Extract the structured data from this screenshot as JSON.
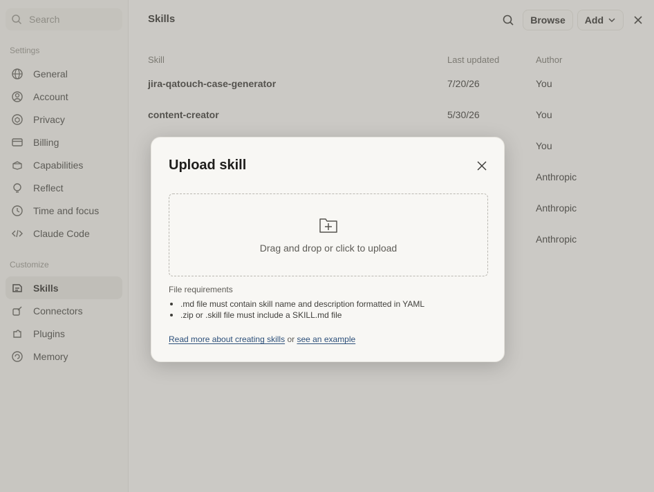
{
  "sidebar": {
    "search_placeholder": "Search",
    "settings_title": "Settings",
    "settings_items": [
      {
        "label": "General",
        "icon": "globe-icon"
      },
      {
        "label": "Account",
        "icon": "user-icon"
      },
      {
        "label": "Privacy",
        "icon": "shield-icon"
      },
      {
        "label": "Billing",
        "icon": "credit-card-icon"
      },
      {
        "label": "Capabilities",
        "icon": "cube-icon"
      },
      {
        "label": "Reflect",
        "icon": "lightbulb-icon"
      },
      {
        "label": "Time and focus",
        "icon": "clock-icon"
      },
      {
        "label": "Claude Code",
        "icon": "code-icon"
      }
    ],
    "customize_title": "Customize",
    "customize_items": [
      {
        "label": "Skills",
        "icon": "skills-icon",
        "active": true
      },
      {
        "label": "Connectors",
        "icon": "plug-icon"
      },
      {
        "label": "Plugins",
        "icon": "puzzle-icon"
      },
      {
        "label": "Memory",
        "icon": "memory-icon"
      }
    ]
  },
  "header": {
    "title": "Skills",
    "browse_label": "Browse",
    "add_label": "Add"
  },
  "table": {
    "columns": [
      "Skill",
      "Last updated",
      "Author"
    ],
    "rows": [
      {
        "skill": "jira-qatouch-case-generator",
        "updated": "7/20/26",
        "author": "You"
      },
      {
        "skill": "content-creator",
        "updated": "5/30/26",
        "author": "You"
      },
      {
        "skill": "",
        "updated": "",
        "author": "You"
      },
      {
        "skill": "",
        "updated": "",
        "author": "Anthropic"
      },
      {
        "skill": "",
        "updated": "",
        "author": "Anthropic"
      },
      {
        "skill": "",
        "updated": "",
        "author": "Anthropic"
      }
    ]
  },
  "modal": {
    "title": "Upload skill",
    "dropzone_text": "Drag and drop or click to upload",
    "requirements_title": "File requirements",
    "requirements": [
      ".md file must contain skill name and description formatted in YAML",
      ".zip or .skill file must include a SKILL.md file"
    ],
    "link_read_more": "Read more about creating skills",
    "link_or": "or",
    "link_example": "see an example"
  }
}
